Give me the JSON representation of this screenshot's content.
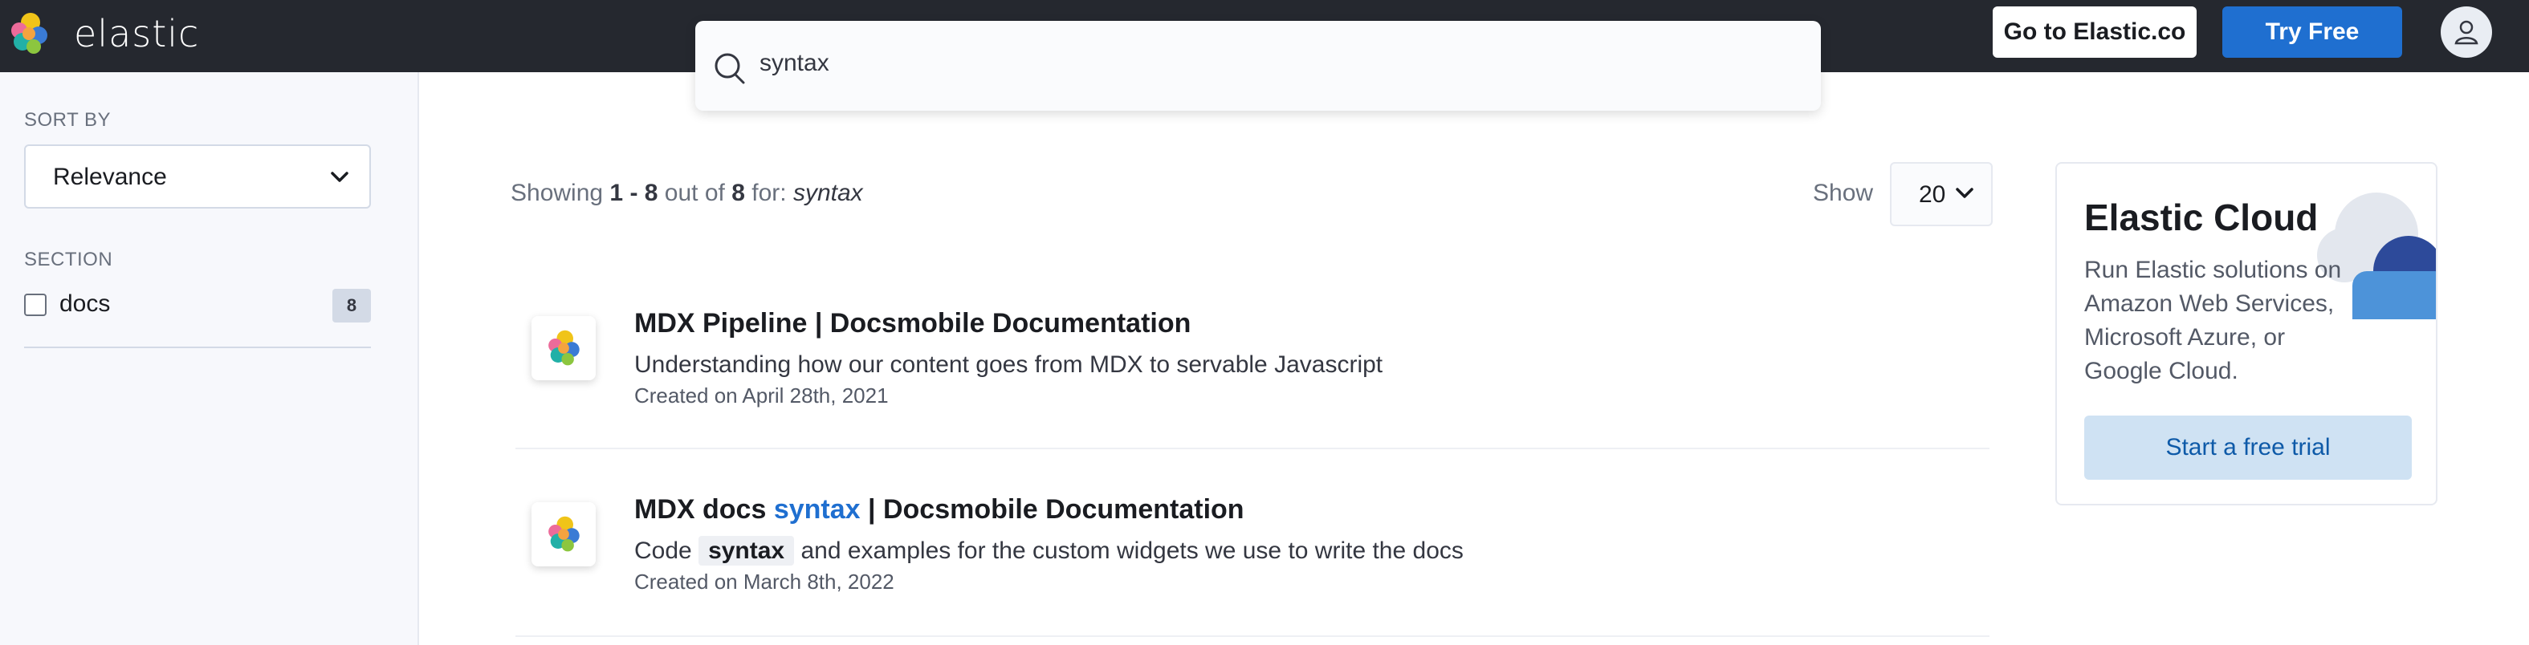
{
  "header": {
    "logo_text": "elastic",
    "go_button": "Go to Elastic.co",
    "try_button": "Try Free"
  },
  "search": {
    "value": "syntax"
  },
  "sidebar": {
    "sort_label": "SORT BY",
    "sort_value": "Relevance",
    "section_label": "SECTION",
    "facets": [
      {
        "label": "docs",
        "count": "8",
        "checked": false
      }
    ]
  },
  "results_meta": {
    "prefix": "Showing",
    "range": "1 - 8",
    "outof": "out of",
    "total": "8",
    "for": "for:",
    "query": "syntax",
    "show_label": "Show",
    "show_value": "20"
  },
  "results": [
    {
      "title": "MDX Pipeline | Docsmobile Documentation",
      "description": "Understanding how our content goes from MDX to servable Javascript",
      "date": "Created on April 28th, 2021"
    },
    {
      "title_before": "MDX docs",
      "title_highlight": "syntax",
      "title_after": "| Docsmobile Documentation",
      "desc_before": "Code",
      "desc_code": "syntax",
      "desc_after": "and examples for the custom widgets we use to write the docs",
      "date": "Created on March 8th, 2022"
    }
  ],
  "promo": {
    "title": "Elastic Cloud",
    "text": "Run Elastic solutions on Amazon Web Services, Microsoft Azure, or Google Cloud.",
    "button": "Start a free trial"
  },
  "colors": {
    "header_bg": "#25282f",
    "accent": "#1f6fd0",
    "highlight": "#1f6fd0"
  },
  "icons": [
    "elastic-logo-icon",
    "search-icon",
    "chevron-down-icon",
    "user-icon",
    "cloud-icon"
  ]
}
